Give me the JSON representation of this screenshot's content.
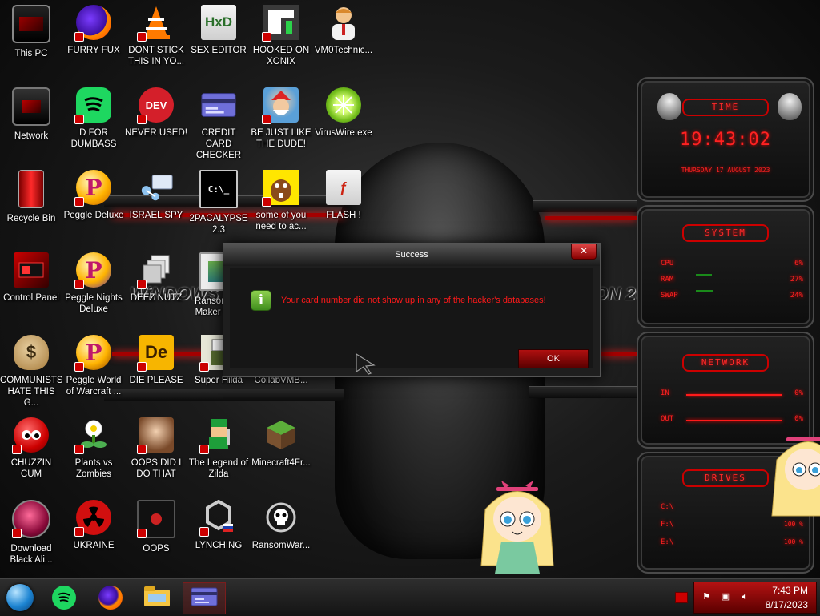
{
  "desktop": {
    "icons": [
      {
        "label": "This PC",
        "icon": "monitor-icon"
      },
      {
        "label": "FURRY FUX",
        "icon": "firefox-icon"
      },
      {
        "label": "DONT STICK THIS IN YO...",
        "icon": "vlc-cone-icon"
      },
      {
        "label": "SEX EDITOR",
        "icon": "hxd-editor-icon"
      },
      {
        "label": "HOOKED ON XONIX",
        "icon": "xonix-game-icon"
      },
      {
        "label": "VM0Technic...",
        "icon": "technician-icon"
      },
      {
        "label": "Network",
        "icon": "network-icon"
      },
      {
        "label": "D FOR DUMBASS",
        "icon": "spotify-icon"
      },
      {
        "label": "NEVER USED!",
        "icon": "devcpp-icon"
      },
      {
        "label": "CREDIT CARD CHECKER",
        "icon": "credit-card-icon"
      },
      {
        "label": "BE JUST LIKE THE DUDE!",
        "icon": "elf-icon"
      },
      {
        "label": "VirusWire.exe",
        "icon": "lime-icon"
      },
      {
        "label": "Recycle Bin",
        "icon": "recycle-bin-icon"
      },
      {
        "label": "Peggle Deluxe",
        "icon": "peggle-icon"
      },
      {
        "label": "ISRAEL SPY",
        "icon": "spy-icon"
      },
      {
        "label": "2PACALYPSE 2.3",
        "icon": "terminal-icon"
      },
      {
        "label": "some of you need to ac...",
        "icon": "beaver-icon"
      },
      {
        "label": "FLASH !",
        "icon": "flash-icon"
      },
      {
        "label": "Control Panel",
        "icon": "control-panel-icon"
      },
      {
        "label": "Peggle Nights Deluxe",
        "icon": "peggle-icon"
      },
      {
        "label": "DEEZ NUTZ",
        "icon": "stack-icon"
      },
      {
        "label": "Ransomw... Maker Bu...",
        "icon": "ransomware-maker-icon"
      },
      {
        "label": "COMMUNISTS HATE THIS G...",
        "icon": "money-bag-icon"
      },
      {
        "label": "Peggle World of Warcraft ...",
        "icon": "peggle-icon"
      },
      {
        "label": "DIE PLEASE",
        "icon": "de-icon"
      },
      {
        "label": "Super Hilda",
        "icon": "hilda-icon"
      },
      {
        "label": "CollabVMB...",
        "icon": "collabvm-icon"
      },
      {
        "label": "CHUZZIN CUM",
        "icon": "chuzzle-icon"
      },
      {
        "label": "Plants vs Zombies",
        "icon": "plant-icon"
      },
      {
        "label": "OOPS DID I DO THAT",
        "icon": "portrait-icon"
      },
      {
        "label": "The Legend of Zilda",
        "icon": "zelda-icon"
      },
      {
        "label": "Minecraft4Fr...",
        "icon": "grass-block-icon"
      },
      {
        "label": "Download Black Ali...",
        "icon": "alien-orb-icon"
      },
      {
        "label": "UKRAINE",
        "icon": "radiation-icon"
      },
      {
        "label": "OOPS",
        "icon": "oops-icon"
      },
      {
        "label": "LYNCHING",
        "icon": "lynching-icon"
      },
      {
        "label": "RansomWar...",
        "icon": "skull-icon"
      }
    ]
  },
  "wallpaper": {
    "left_text": "WiNDOWS 8.1",
    "right_text": "ON 20"
  },
  "gadgets": {
    "time": {
      "title": "TIME",
      "clock": "19:43:02",
      "date": "THURSDAY 17 AUGUST 2023"
    },
    "system": {
      "title": "SYSTEM",
      "rows": [
        {
          "label": "CPU",
          "value": "6%"
        },
        {
          "label": "RAM",
          "value": "27%"
        },
        {
          "label": "SWAP",
          "value": "24%"
        }
      ]
    },
    "network": {
      "title": "NETWORK",
      "rows": [
        {
          "label": "IN",
          "value": "0%"
        },
        {
          "label": "OUT",
          "value": "0%"
        }
      ]
    },
    "drives": {
      "title": "DRIVES",
      "rows": [
        {
          "label": "C:\\",
          "value": ""
        },
        {
          "label": "F:\\",
          "value": "100 %"
        },
        {
          "label": "E:\\",
          "value": "100 %"
        }
      ]
    }
  },
  "dialog": {
    "title": "Success",
    "message": "Your card number did not show up in any of the hacker's databases!",
    "ok_label": "OK",
    "close_glyph": "✕"
  },
  "taskbar": {
    "pinned": [
      {
        "name": "spotify-icon"
      },
      {
        "name": "firefox-icon"
      },
      {
        "name": "file-explorer-icon"
      },
      {
        "name": "credit-card-checker-icon"
      }
    ],
    "time": "7:43 PM",
    "date": "8/17/2023"
  },
  "colors": {
    "accent_red": "#ff1a1a",
    "dialog_bg": "#1e1e1e",
    "tray_red": "#b31212"
  }
}
